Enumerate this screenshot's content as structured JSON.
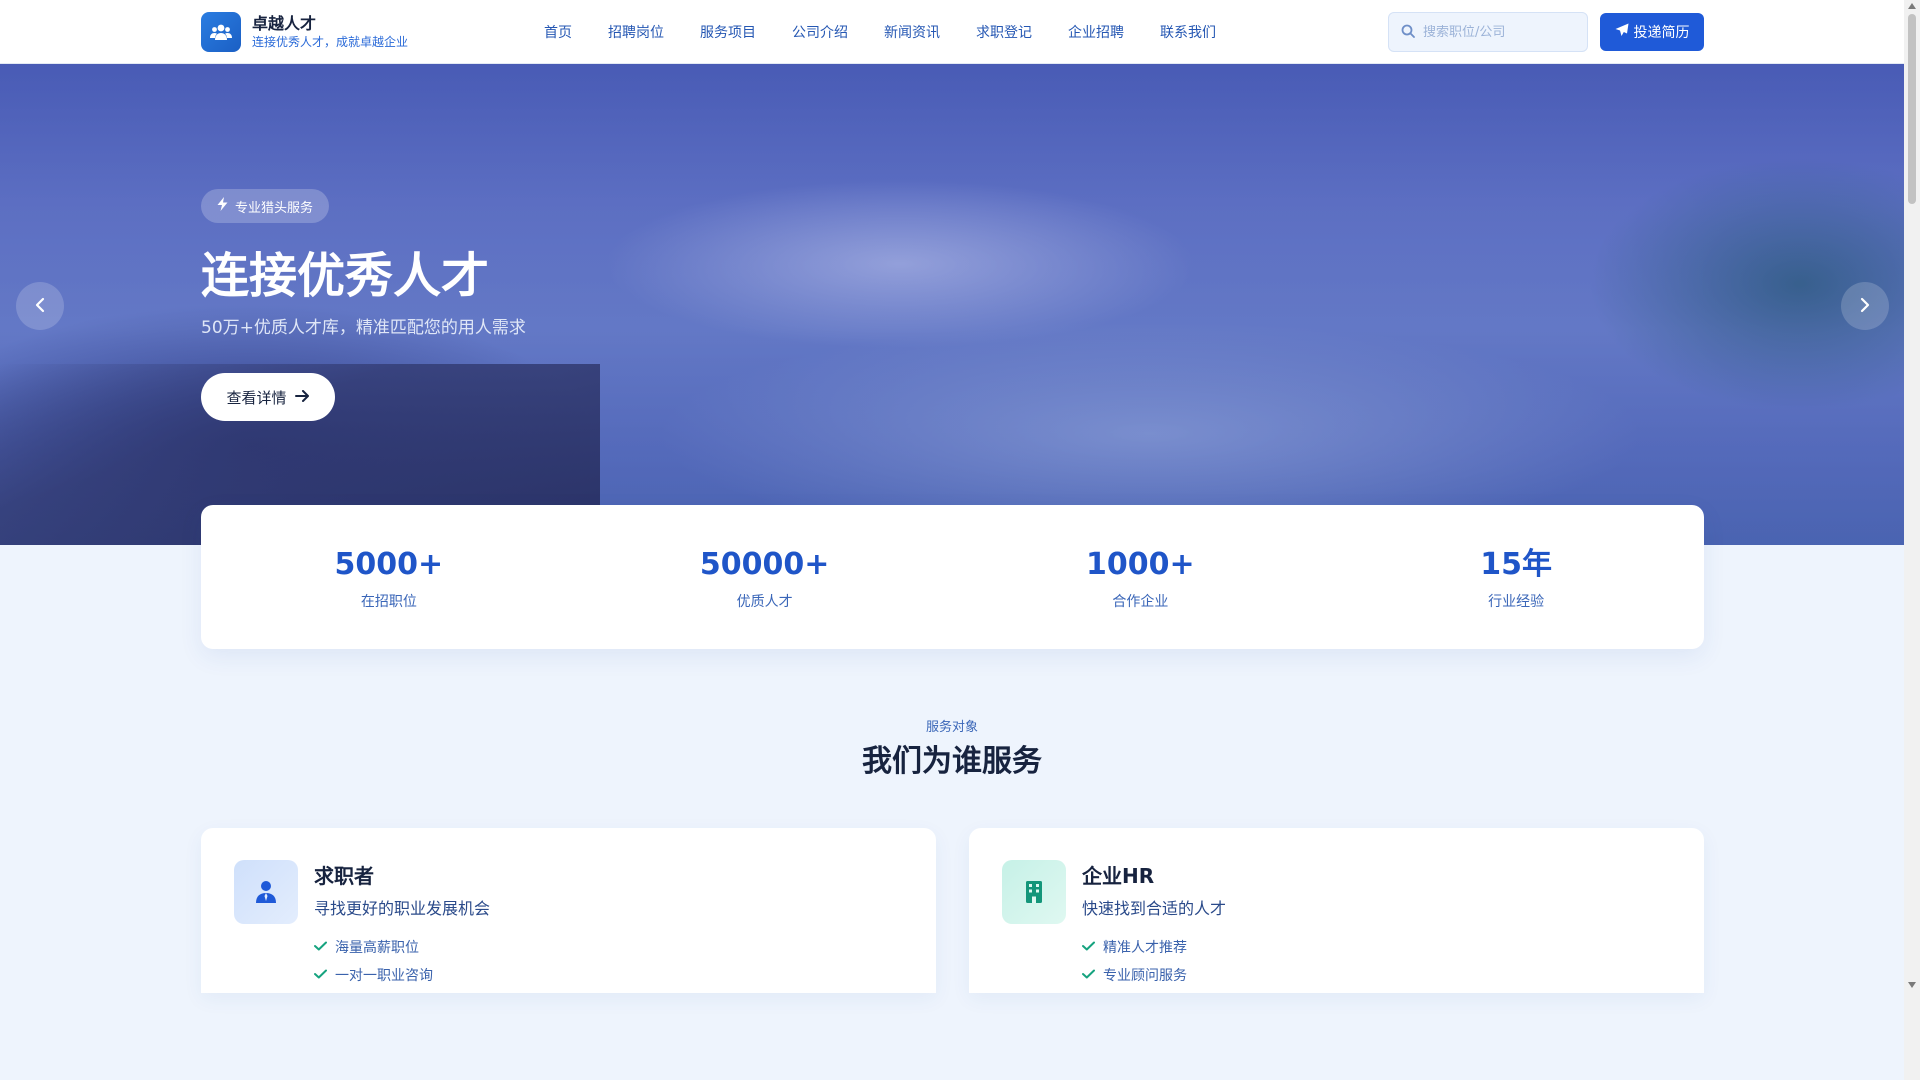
{
  "brand": {
    "title": "卓越人才",
    "slogan": "连接优秀人才，成就卓越企业"
  },
  "nav": {
    "items": [
      "首页",
      "招聘岗位",
      "服务项目",
      "公司介绍",
      "新闻资讯",
      "求职登记",
      "企业招聘",
      "联系我们"
    ]
  },
  "search": {
    "placeholder": "搜索职位/公司",
    "icon": "search-icon"
  },
  "header_button": {
    "label": "投递简历",
    "icon": "paper-plane-icon"
  },
  "hero": {
    "tag": "专业猎头服务",
    "tag_icon": "bolt-icon",
    "title": "连接优秀人才",
    "description": "50万+优质人才库，精准匹配您的用人需求",
    "button": "查看详情",
    "button_icon": "arrow-right-icon"
  },
  "stats": [
    {
      "value": "5000+",
      "label": "在招职位"
    },
    {
      "value": "50000+",
      "label": "优质人才"
    },
    {
      "value": "1000+",
      "label": "合作企业"
    },
    {
      "value": "15年",
      "label": "行业经验"
    }
  ],
  "section": {
    "subtitle": "服务对象",
    "title": "我们为谁服务"
  },
  "cards": [
    {
      "title": "求职者",
      "description": "寻找更好的职业发展机会",
      "icon": "user-tie-icon",
      "features": [
        "海量高薪职位",
        "一对一职业咨询"
      ]
    },
    {
      "title": "企业HR",
      "description": "快速找到合适的人才",
      "icon": "building-icon",
      "features": [
        "精准人才推荐",
        "专业顾问服务"
      ]
    }
  ],
  "colors": {
    "primary": "#1f5ad8",
    "accent_text": "#2557b3",
    "check_green": "#16a37f",
    "page_bg": "#eef4fd"
  }
}
